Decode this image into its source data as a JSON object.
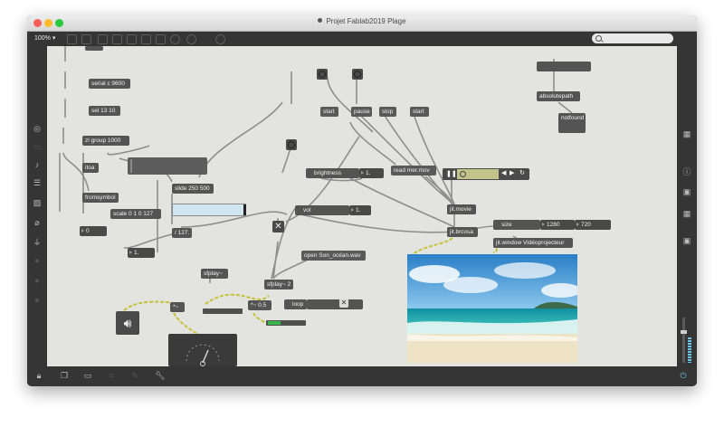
{
  "window": {
    "title": "Projet Fablab2019 Plage"
  },
  "toolbar": {
    "zoom": "100%"
  },
  "patch": {
    "serial": "serial c 9600",
    "sel": "sel 13 10",
    "zl_group": "zl group 1000",
    "itoa": "itoa",
    "fromsymbol": "fromsymbol",
    "scale": "scale 0 1 0 127",
    "number_zero": "0",
    "slide": "slide 250 500",
    "div_127": "/ 127.",
    "one_float": "1.",
    "sfplay1": "sfplay~",
    "sfplay2": "sfplay~ 2",
    "times_05": "*~ 0.5",
    "times": "*~",
    "loop": "loop",
    "open_file": "open Son_océan.wav",
    "start1": "start",
    "pause": "pause",
    "stop": "stop",
    "start2": "start",
    "brightness": "brightness",
    "brightness_val": "1.",
    "vol": "vol",
    "vol_val": "1.",
    "read_movie": "read mer.mov",
    "jit_movie": "jit.movie",
    "jit_brcosa": "jit.brcosa",
    "size": "size",
    "width": "1280",
    "height": "720",
    "jit_window": "jit.window Vidéoprojecteur",
    "absolutepath": "absolutepath",
    "notfound": "notfound"
  },
  "icons": {
    "toggle_x": "✕",
    "left": [
      "target-icon",
      "list-icon",
      "music-note-icon",
      "playlist-icon",
      "image-icon",
      "clip-icon",
      "plug-icon",
      "circle-icon",
      "circle-icon",
      "star-icon"
    ],
    "right": [
      "grid-icon",
      "info-icon",
      "book-icon",
      "calendar-icon",
      "book-icon"
    ],
    "bottom": [
      "lock-icon",
      "windows-icon",
      "presentation-icon",
      "grid-icon",
      "tools-icon",
      "wrench-icon",
      "power-icon"
    ]
  },
  "colors": {
    "canvas": "#e3e3df",
    "object": "#545454",
    "signal_wire": "#c7c13a",
    "accent": "#6ec6e6"
  }
}
